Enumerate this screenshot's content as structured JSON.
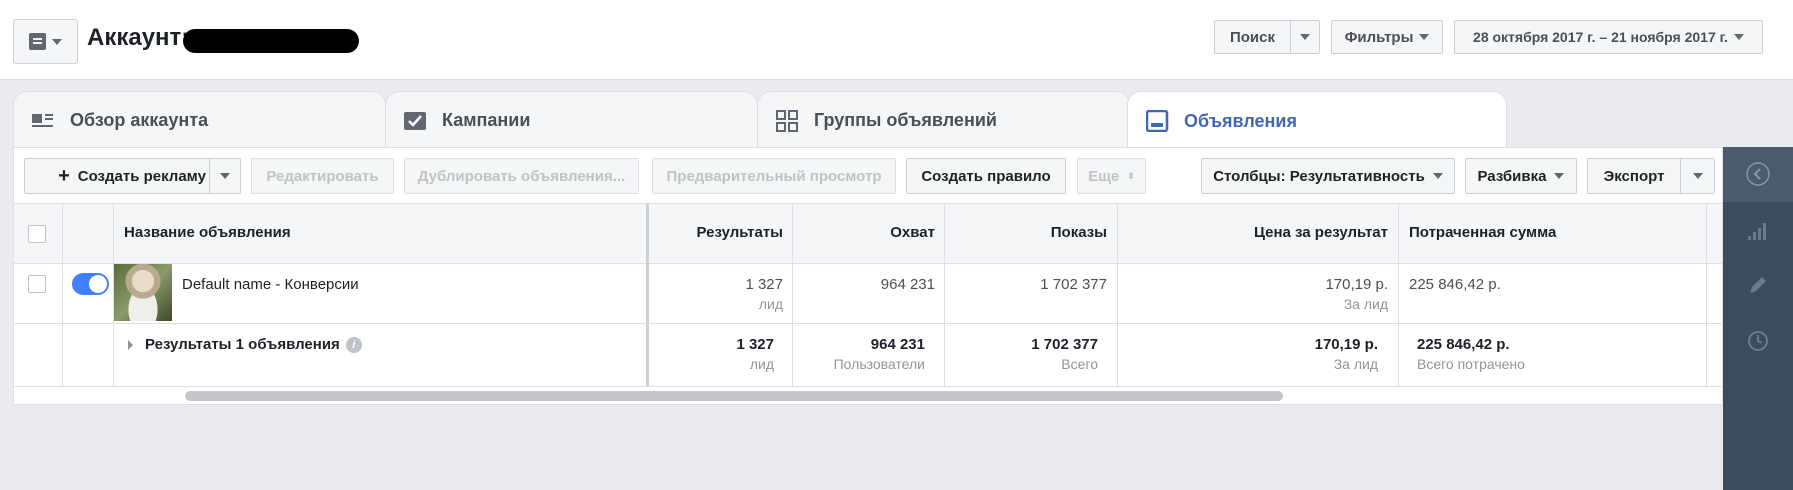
{
  "header": {
    "account_label": "Аккаунт:",
    "search_label": "Поиск",
    "filters_label": "Фильтры",
    "date_range": "28 октября 2017 г. – 21 ноября 2017 г."
  },
  "tabs": [
    {
      "label": "Обзор аккаунта",
      "icon": "account-overview-icon"
    },
    {
      "label": "Кампании",
      "icon": "campaigns-check-icon"
    },
    {
      "label": "Группы объявлений",
      "icon": "adsets-grid-icon"
    },
    {
      "label": "Объявления",
      "icon": "ads-icon",
      "active": true
    }
  ],
  "toolbar": {
    "create_ad": "Создать рекламу",
    "edit": "Редактировать",
    "duplicate": "Дублировать объявления...",
    "preview": "Предварительный просмотр",
    "create_rule": "Создать правило",
    "more": "Еще",
    "columns": "Столбцы: Результативность",
    "breakdown": "Разбивка",
    "export": "Экспорт"
  },
  "table": {
    "headers": [
      "Название объявления",
      "Результаты",
      "Охват",
      "Показы",
      "Цена за результат",
      "Потраченная сумма"
    ],
    "rows": [
      {
        "name": "Default name - Конверсии",
        "results": "1 327",
        "results_sub": "лид",
        "reach": "964 231",
        "impressions": "1 702 377",
        "cost_per_result": "170,19 р.",
        "cost_sub": "За лид",
        "spent": "225 846,42 р."
      }
    ],
    "summary": {
      "label": "Результаты 1 объявления",
      "results": "1 327",
      "results_sub": "лид",
      "reach": "964 231",
      "reach_sub": "Пользователи",
      "impressions": "1 702 377",
      "impressions_sub": "Всего",
      "cost_per_result": "170,19 р.",
      "cost_sub": "За лид",
      "spent": "225 846,42 р.",
      "spent_sub": "Всего потрачено"
    }
  },
  "colors": {
    "accent": "#4267b2",
    "toggle": "#4080ff",
    "rail": "#3d4b5d"
  }
}
